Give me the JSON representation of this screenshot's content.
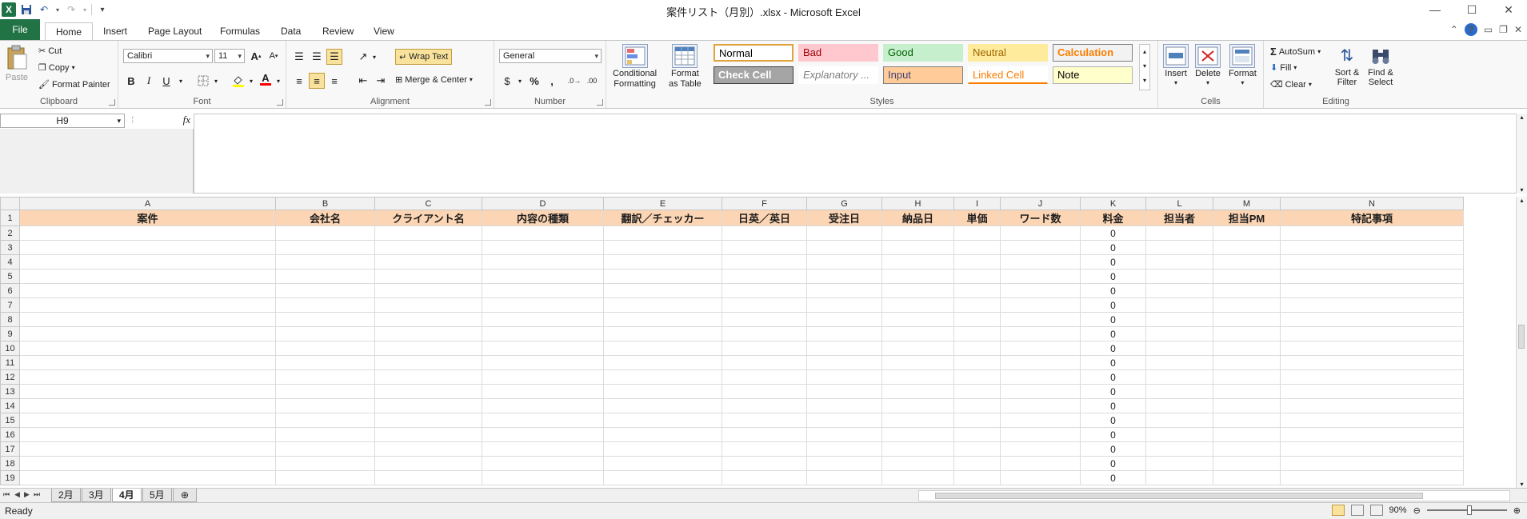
{
  "window": {
    "title": "案件リスト（月別）.xlsx - Microsoft Excel",
    "controls": [
      "—",
      "☐",
      "✕"
    ]
  },
  "tabs": [
    "File",
    "Home",
    "Insert",
    "Page Layout",
    "Formulas",
    "Data",
    "Review",
    "View"
  ],
  "active_tab": "Home",
  "ribbon": {
    "clipboard": {
      "label": "Clipboard",
      "paste": "Paste",
      "cut": "Cut",
      "copy": "Copy",
      "format_painter": "Format Painter"
    },
    "font": {
      "label": "Font",
      "font_name": "Calibri",
      "font_size": "11"
    },
    "alignment": {
      "label": "Alignment",
      "wrap_text": "Wrap Text",
      "merge_center": "Merge & Center"
    },
    "number": {
      "label": "Number",
      "format": "General"
    },
    "styles": {
      "label": "Styles",
      "conditional": [
        "Conditional",
        "Formatting"
      ],
      "format_table": [
        "Format",
        "as Table"
      ],
      "cells": [
        {
          "name": "Normal",
          "bg": "#ffffff",
          "fg": "#000000",
          "border": "#e0a33a"
        },
        {
          "name": "Bad",
          "bg": "#ffc7ce",
          "fg": "#9c0006",
          "border": "#ffc7ce"
        },
        {
          "name": "Good",
          "bg": "#c6efce",
          "fg": "#006100",
          "border": "#c6efce"
        },
        {
          "name": "Neutral",
          "bg": "#ffeb9c",
          "fg": "#9c6500",
          "border": "#ffeb9c"
        },
        {
          "name": "Calculation",
          "bg": "#f2f2f2",
          "fg": "#fa7d00",
          "border": "#7f7f7f"
        },
        {
          "name": "Check Cell",
          "bg": "#a5a5a5",
          "fg": "#ffffff",
          "border": "#3f3f3f"
        },
        {
          "name": "Explanatory ...",
          "bg": "#ffffff",
          "fg": "#7f7f7f",
          "border": "#ffffff"
        },
        {
          "name": "Input",
          "bg": "#ffcc99",
          "fg": "#3f3f76",
          "border": "#7f7f7f"
        },
        {
          "name": "Linked Cell",
          "bg": "#ffffff",
          "fg": "#fa7d00",
          "border": "#ffffff"
        },
        {
          "name": "Note",
          "bg": "#ffffcc",
          "fg": "#000000",
          "border": "#b2b2b2"
        }
      ]
    },
    "cells": {
      "label": "Cells",
      "insert": "Insert",
      "delete": "Delete",
      "format": "Format"
    },
    "editing": {
      "label": "Editing",
      "autosum": "AutoSum",
      "fill": "Fill",
      "clear": "Clear",
      "sort": [
        "Sort &",
        "Filter"
      ],
      "find": [
        "Find &",
        "Select"
      ]
    }
  },
  "formula_bar": {
    "name_box": "H9",
    "fx": "fx",
    "value": ""
  },
  "sheet": {
    "columns": [
      {
        "letter": "A",
        "header": "案件"
      },
      {
        "letter": "B",
        "header": "会社名"
      },
      {
        "letter": "C",
        "header": "クライアント名"
      },
      {
        "letter": "D",
        "header": "内容の種類"
      },
      {
        "letter": "E",
        "header": "翻訳／チェッカー"
      },
      {
        "letter": "F",
        "header": "日英／英日"
      },
      {
        "letter": "G",
        "header": "受注日"
      },
      {
        "letter": "H",
        "header": "納品日"
      },
      {
        "letter": "I",
        "header": "単価"
      },
      {
        "letter": "J",
        "header": "ワード数"
      },
      {
        "letter": "K",
        "header": "料金"
      },
      {
        "letter": "L",
        "header": "担当者"
      },
      {
        "letter": "M",
        "header": "担当PM"
      },
      {
        "letter": "N",
        "header": "特記事項"
      }
    ],
    "row_numbers": [
      "1",
      "2",
      "3",
      "4",
      "5",
      "6",
      "7",
      "8",
      "9",
      "10",
      "11",
      "12",
      "13",
      "14",
      "15",
      "16",
      "17",
      "18",
      "19"
    ],
    "fee_values": [
      "0",
      "0",
      "0",
      "0",
      "0",
      "0",
      "0",
      "0",
      "0",
      "0",
      "0",
      "0",
      "0",
      "0",
      "0",
      "0",
      "0",
      "0"
    ],
    "header_bg": "#fcd5b4"
  },
  "sheet_tabs": [
    "2月",
    "3月",
    "4月",
    "5月"
  ],
  "active_sheet": "4月",
  "status": {
    "text": "Ready",
    "zoom": "90%"
  }
}
